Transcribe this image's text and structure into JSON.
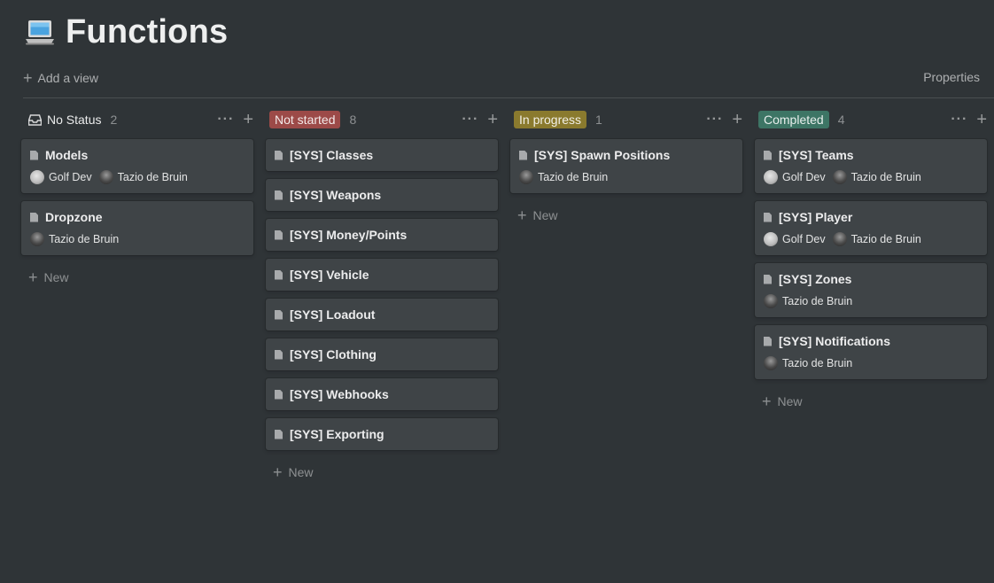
{
  "page": {
    "title": "Functions",
    "icon": "laptop-icon"
  },
  "toolbar": {
    "add_view_label": "Add a view",
    "properties_label": "Properties"
  },
  "colors": {
    "background": "#2f3437",
    "card": "#3f4447",
    "not_started": "#9c4a48",
    "in_progress": "#8a7a2e",
    "completed": "#3d7565"
  },
  "new_label": "New",
  "columns": [
    {
      "name": "No Status",
      "count": "2",
      "cards": [
        {
          "title": "Models",
          "people": [
            "Golf Dev",
            "Tazio de Bruin"
          ]
        },
        {
          "title": "Dropzone",
          "people": [
            "Tazio de Bruin"
          ]
        }
      ]
    },
    {
      "name": "Not started",
      "count": "8",
      "cards": [
        {
          "title": "[SYS] Classes"
        },
        {
          "title": "[SYS] Weapons"
        },
        {
          "title": "[SYS] Money/Points"
        },
        {
          "title": "[SYS] Vehicle"
        },
        {
          "title": "[SYS] Loadout"
        },
        {
          "title": "[SYS] Clothing"
        },
        {
          "title": "[SYS] Webhooks"
        },
        {
          "title": "[SYS] Exporting"
        }
      ]
    },
    {
      "name": "In progress",
      "count": "1",
      "cards": [
        {
          "title": "[SYS] Spawn Positions",
          "people": [
            "Tazio de Bruin"
          ]
        }
      ]
    },
    {
      "name": "Completed",
      "count": "4",
      "cards": [
        {
          "title": "[SYS] Teams",
          "people": [
            "Golf Dev",
            "Tazio de Bruin"
          ]
        },
        {
          "title": "[SYS] Player",
          "people": [
            "Golf Dev",
            "Tazio de Bruin"
          ]
        },
        {
          "title": "[SYS] Zones",
          "people": [
            "Tazio de Bruin"
          ]
        },
        {
          "title": "[SYS] Notifications",
          "people": [
            "Tazio de Bruin"
          ]
        }
      ]
    }
  ]
}
